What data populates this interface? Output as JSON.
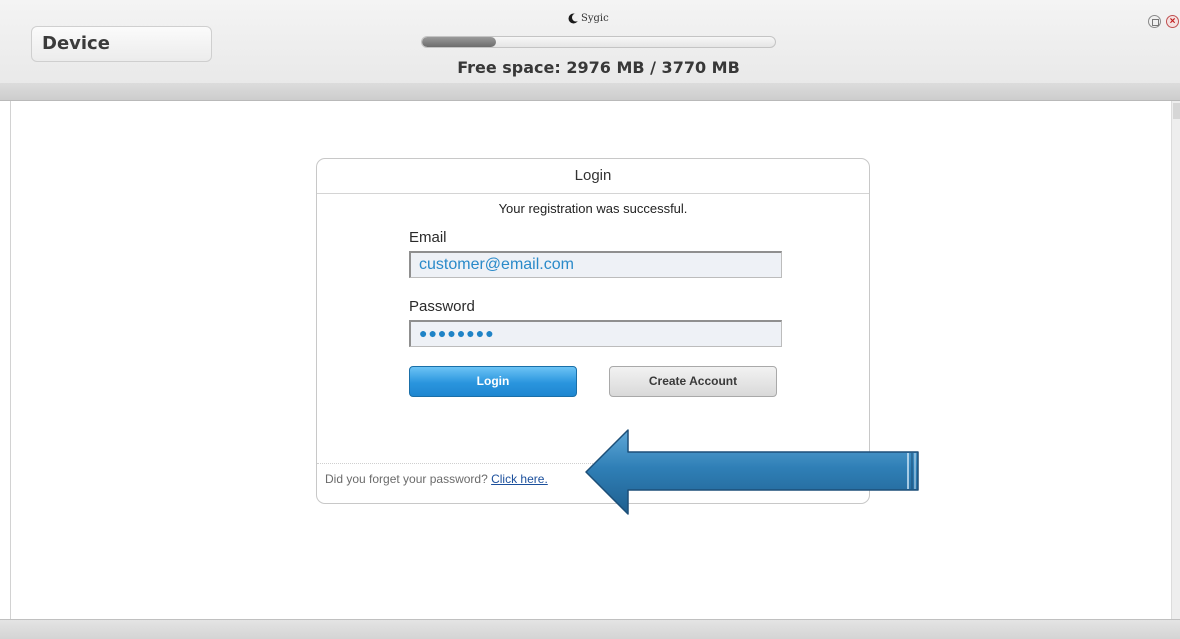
{
  "window": {
    "brand_name": "Sygic",
    "restore_icon": "restore-icon",
    "close_icon": "close-icon"
  },
  "header": {
    "device_label": "Device",
    "storage": {
      "free_space_text": "Free space: 2976 MB / 3770 MB",
      "used_fraction": 0.21
    }
  },
  "login": {
    "title": "Login",
    "success_message": "Your registration was successful.",
    "email_label": "Email",
    "email_value": "customer@email.com",
    "password_label": "Password",
    "password_mask": "●●●●●●●●",
    "login_button": "Login",
    "create_account_button": "Create Account",
    "forgot_text": "Did you forget your password?",
    "forgot_link": "Click here."
  },
  "colors": {
    "accent_blue": "#2a95de",
    "link_blue": "#1b4f9c",
    "arrow_blue": "#2f7fb6"
  }
}
